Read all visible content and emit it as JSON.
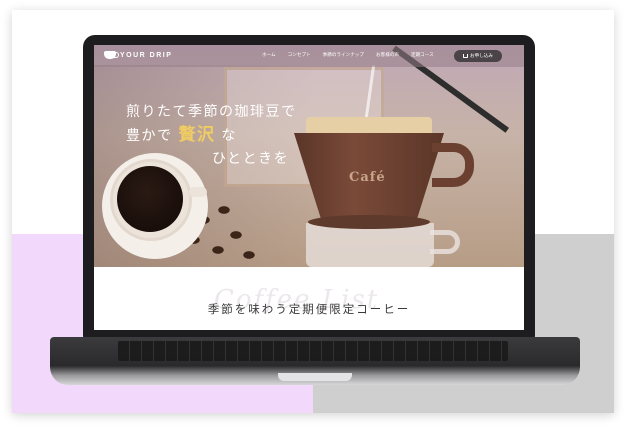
{
  "brand": {
    "name": "YOUR DRIP"
  },
  "nav": {
    "links": [
      "ホーム",
      "コンセプト",
      "季節のラインナップ",
      "お客様の声",
      "定期コース"
    ],
    "apply_label": "お申し込み"
  },
  "hero": {
    "line1": "煎りたて季節の珈琲豆で",
    "line2_pre": "豊かで",
    "line2_highlight": "贅沢",
    "line2_post": "な",
    "line3": "ひとときを",
    "dripper_label": "Café"
  },
  "section": {
    "title": "季節を味わう定期便限定コーヒー",
    "watermark": "Coffee List"
  },
  "colors": {
    "accent": "#f0cc62",
    "button_bg": "#4a4448",
    "band_left": "#f2d9fb",
    "band_right": "#cfcfcf"
  }
}
